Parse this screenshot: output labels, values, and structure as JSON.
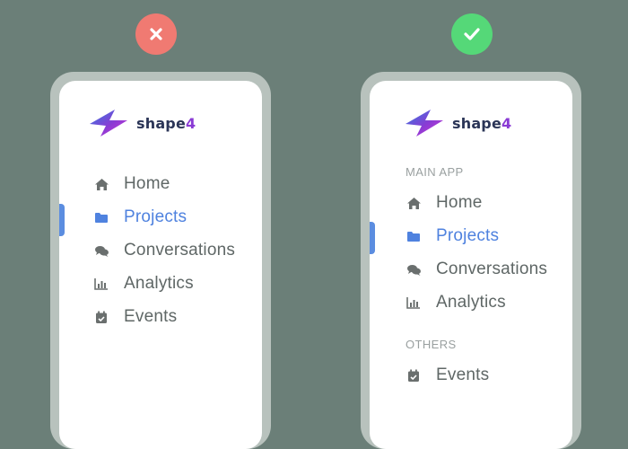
{
  "logo": {
    "name": "shape",
    "num": "4"
  },
  "left_panel": {
    "items": [
      {
        "label": "Home",
        "icon": "home-icon"
      },
      {
        "label": "Projects",
        "icon": "folder-icon",
        "active": true
      },
      {
        "label": "Conversations",
        "icon": "chat-icon"
      },
      {
        "label": "Analytics",
        "icon": "analytics-icon"
      },
      {
        "label": "Events",
        "icon": "calendar-icon"
      }
    ]
  },
  "right_panel": {
    "sections": [
      {
        "title": "MAIN APP",
        "items": [
          {
            "label": "Home",
            "icon": "home-icon"
          },
          {
            "label": "Projects",
            "icon": "folder-icon",
            "active": true
          },
          {
            "label": "Conversations",
            "icon": "chat-icon"
          },
          {
            "label": "Analytics",
            "icon": "analytics-icon"
          }
        ]
      },
      {
        "title": "OTHERS",
        "items": [
          {
            "label": "Events",
            "icon": "calendar-icon"
          }
        ]
      }
    ]
  },
  "colors": {
    "accent": "#4f82df",
    "text": "#5f6766",
    "bad": "#f07a72",
    "good": "#55d878"
  }
}
